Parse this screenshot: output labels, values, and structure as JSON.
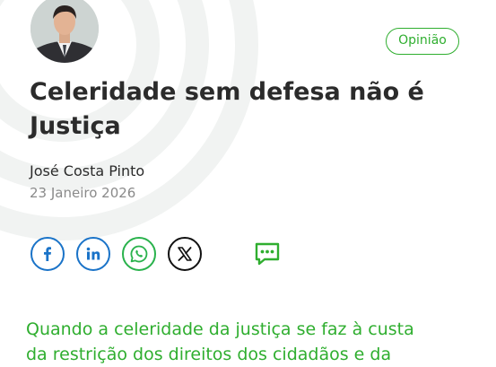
{
  "article": {
    "category": "Opinião",
    "title": "Celeridade sem defesa não é Justiça",
    "author": "José Costa Pinto",
    "date": "23 Janeiro 2026",
    "lead_line1": "Quando a celeridade da justiça se faz à custa",
    "lead_line2": "da restrição dos direitos dos cidadãos e da"
  },
  "share": {
    "icons": [
      "facebook-icon",
      "linkedin-icon",
      "whatsapp-icon",
      "x-icon",
      "comment-icon"
    ]
  },
  "colors": {
    "accent": "#2fae2f",
    "facebook": "#1a73c8",
    "linkedin": "#1a73c8",
    "whatsapp": "#29b24c",
    "x": "#111111"
  }
}
